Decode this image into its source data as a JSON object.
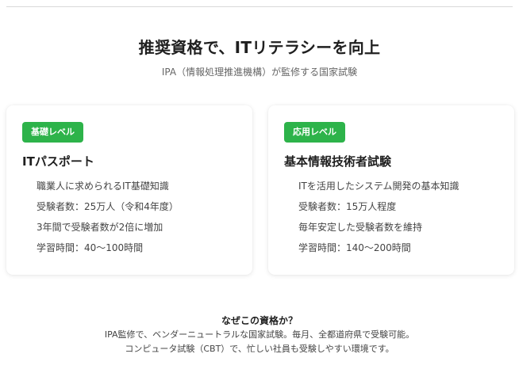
{
  "hero": {
    "title": "推奨資格で、ITリテラシーを向上",
    "subtitle": "IPA（情報処理推進機構）が監修する国家試験"
  },
  "cards": [
    {
      "badge": "基礎レベル",
      "title": "ITパスポート",
      "items": [
        "職業人に求められるIT基礎知識",
        "受験者数：25万人（令和4年度）",
        "3年間で受験者数が2倍に増加",
        "学習時間：40〜100時間"
      ]
    },
    {
      "badge": "応用レベル",
      "title": "基本情報技術者試験",
      "items": [
        "ITを活用したシステム開発の基本知識",
        "受験者数：15万人程度",
        "毎年安定した受験者数を維持",
        "学習時間：140〜200時間"
      ]
    }
  ],
  "why": {
    "heading": "なぜこの資格か？",
    "line1": "IPA監修で、ベンダーニュートラルな国家試験。毎月、全都道府県で受験可能。",
    "line2": "コンピュータ試験（CBT）で、忙しい社員も受験しやすい環境です。"
  },
  "colors": {
    "badge_green": "#2db34a"
  }
}
